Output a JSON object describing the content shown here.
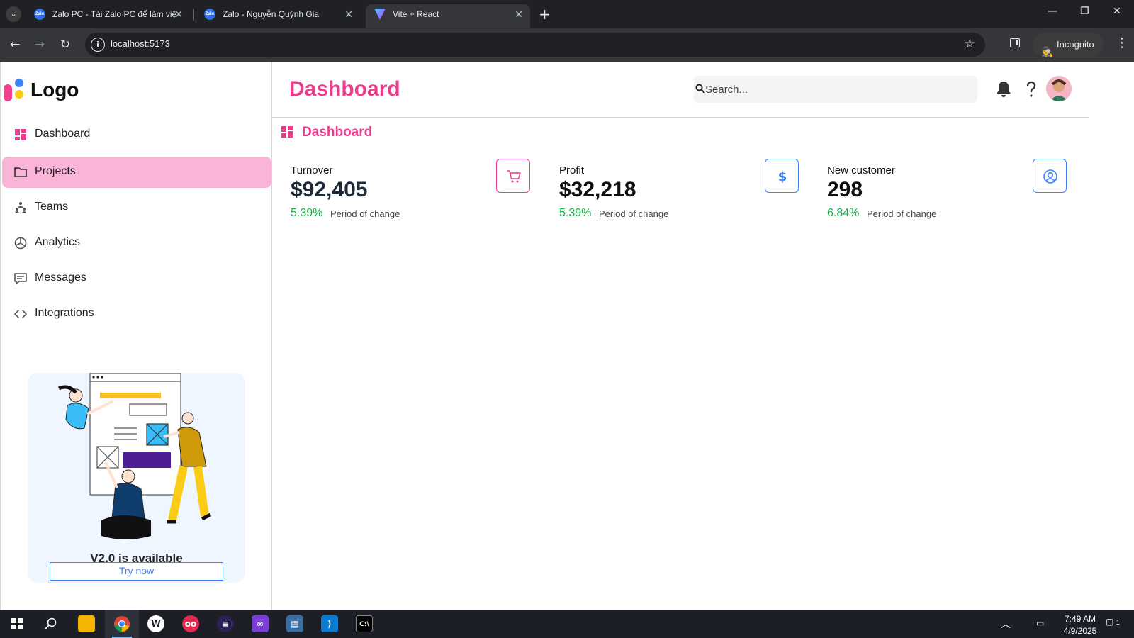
{
  "browser": {
    "tabs": [
      {
        "title": "Zalo PC - Tải Zalo PC để làm việ",
        "favicon": "zalo-icon",
        "active": false
      },
      {
        "title": "Zalo - Nguyễn Quỳnh Gia",
        "favicon": "zalo-icon",
        "active": false
      },
      {
        "title": "Vite + React",
        "favicon": "vite-icon",
        "active": true
      }
    ],
    "favicon_text": "Zalo",
    "url": "localhost:5173",
    "incognito_label": "Incognito"
  },
  "sidebar": {
    "logo_text": "Logo",
    "items": [
      {
        "label": "Dashboard",
        "icon": "dashboard-grid-icon",
        "active": false
      },
      {
        "label": "Projects",
        "icon": "folder-icon",
        "active": true
      },
      {
        "label": "Teams",
        "icon": "teams-icon",
        "active": false
      },
      {
        "label": "Analytics",
        "icon": "pie-chart-icon",
        "active": false
      },
      {
        "label": "Messages",
        "icon": "message-icon",
        "active": false
      },
      {
        "label": "Integrations",
        "icon": "code-icon",
        "active": false
      }
    ],
    "promo": {
      "title": "V2.0 is available",
      "button": "Try now"
    }
  },
  "header": {
    "title": "Dashboard",
    "search_placeholder": "Search..."
  },
  "breadcrumb": {
    "label": "Dashboard"
  },
  "cards": [
    {
      "label": "Turnover",
      "value": "$92,405",
      "change": "5.39%",
      "change_label": "Period of change",
      "icon": "cart-icon",
      "accent": "#ec3c8e"
    },
    {
      "label": "Profit",
      "value": "$32,218",
      "change": "5.39%",
      "change_label": "Period of change",
      "icon": "dollar-icon",
      "accent": "#3b82f6"
    },
    {
      "label": "New customer",
      "value": "298",
      "change": "6.84%",
      "change_label": "Period of change",
      "icon": "user-circle-icon",
      "accent": "#3b82f6"
    }
  ],
  "colors": {
    "brand_pink": "#ec3c8e",
    "active_nav": "#f9b4d7",
    "positive": "#16b048",
    "blue": "#3b82f6"
  },
  "taskbar": {
    "time": "7:49 AM",
    "date": "4/9/2025",
    "notification_count": "1"
  }
}
